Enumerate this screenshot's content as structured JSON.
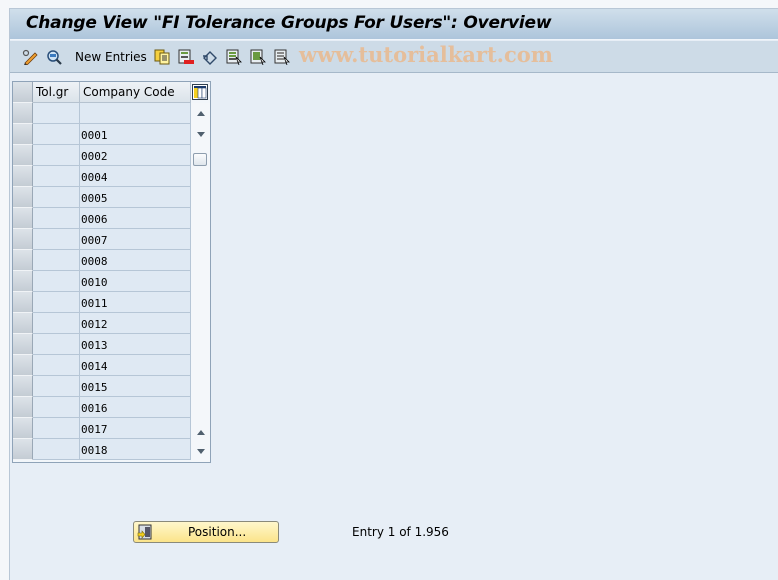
{
  "window": {
    "title": "Change View \"FI Tolerance Groups For Users\": Overview"
  },
  "toolbar": {
    "items": [
      {
        "name": "display-change-icon"
      },
      {
        "name": "find-icon"
      },
      {
        "name": "new-entries",
        "label": "New Entries"
      },
      {
        "name": "copy-icon"
      },
      {
        "name": "delete-icon"
      },
      {
        "name": "undo-icon"
      },
      {
        "name": "select-all-icon"
      },
      {
        "name": "select-block-icon"
      },
      {
        "name": "deselect-all-icon"
      }
    ],
    "new_entries_label": "New Entries",
    "watermark": "www.tutorialkart.com"
  },
  "table": {
    "columns": [
      "Tol.gr",
      "Company Code"
    ],
    "rows": [
      {
        "tolgr": "",
        "company_code": ""
      },
      {
        "tolgr": "",
        "company_code": "0001"
      },
      {
        "tolgr": "",
        "company_code": "0002"
      },
      {
        "tolgr": "",
        "company_code": "0004"
      },
      {
        "tolgr": "",
        "company_code": "0005"
      },
      {
        "tolgr": "",
        "company_code": "0006"
      },
      {
        "tolgr": "",
        "company_code": "0007"
      },
      {
        "tolgr": "",
        "company_code": "0008"
      },
      {
        "tolgr": "",
        "company_code": "0010"
      },
      {
        "tolgr": "",
        "company_code": "0011"
      },
      {
        "tolgr": "",
        "company_code": "0012"
      },
      {
        "tolgr": "",
        "company_code": "0013"
      },
      {
        "tolgr": "",
        "company_code": "0014"
      },
      {
        "tolgr": "",
        "company_code": "0015"
      },
      {
        "tolgr": "",
        "company_code": "0016"
      },
      {
        "tolgr": "",
        "company_code": "0017"
      },
      {
        "tolgr": "",
        "company_code": "0018"
      }
    ]
  },
  "footer": {
    "position_button_label": "Position...",
    "entry_text": "Entry 1 of 1.956"
  },
  "colors": {
    "title_bar": "#bcd0e2",
    "toolbar": "#cddbe7",
    "background": "#e7eef6",
    "cell_background": "#dfe9f3",
    "position_button": "#fbe48a",
    "watermark": "#ecb482"
  }
}
